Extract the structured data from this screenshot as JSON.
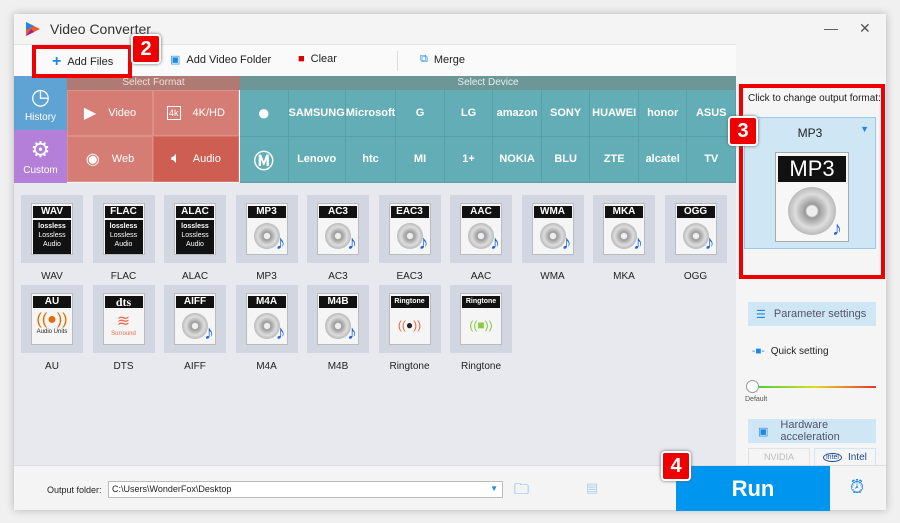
{
  "app": {
    "title": "Video Converter"
  },
  "toolbar": {
    "add_files": "Add Files",
    "add_folder": "Add Video Folder",
    "clear": "Clear",
    "merge": "Merge"
  },
  "categories": {
    "history": "History",
    "custom": "Custom",
    "select_format": "Select Format",
    "select_device": "Select Device",
    "formats": [
      "Video",
      "4K/HD",
      "Web",
      "Audio"
    ],
    "devices": [
      "",
      "SAMSUNG",
      "Microsoft",
      "G",
      "LG",
      "amazon",
      "SONY",
      "HUAWEI",
      "honor",
      "ASUS",
      "",
      "Lenovo",
      "htc",
      "MI",
      "1+",
      "NOKIA",
      "BLU",
      "ZTE",
      "alcatel",
      "TV"
    ]
  },
  "audio_formats": [
    {
      "icon": "WAV",
      "label": "WAV",
      "type": "lossless"
    },
    {
      "icon": "FLAC",
      "label": "FLAC",
      "type": "lossless"
    },
    {
      "icon": "ALAC",
      "label": "ALAC",
      "type": "lossless"
    },
    {
      "icon": "MP3",
      "label": "MP3",
      "type": "disc"
    },
    {
      "icon": "AC3",
      "label": "AC3",
      "type": "disc"
    },
    {
      "icon": "EAC3",
      "label": "EAC3",
      "type": "disc"
    },
    {
      "icon": "AAC",
      "label": "AAC",
      "type": "disc"
    },
    {
      "icon": "WMA",
      "label": "WMA",
      "type": "disc"
    },
    {
      "icon": "MKA",
      "label": "MKA",
      "type": "disc"
    },
    {
      "icon": "OGG",
      "label": "OGG",
      "type": "disc"
    },
    {
      "icon": "AU",
      "label": "AU",
      "type": "au",
      "sub": "Audio Units"
    },
    {
      "icon": "dts",
      "label": "DTS",
      "type": "dts",
      "sub": "Surround"
    },
    {
      "icon": "AIFF",
      "label": "AIFF",
      "type": "disc"
    },
    {
      "icon": "M4A",
      "label": "M4A",
      "type": "disc"
    },
    {
      "icon": "M4B",
      "label": "M4B",
      "type": "disc"
    },
    {
      "icon": "Ringtone",
      "label": "Ringtone",
      "type": "apple"
    },
    {
      "icon": "Ringtone",
      "label": "Ringtone",
      "type": "android"
    }
  ],
  "lossless_text": {
    "logo": "lossless",
    "line1": "Lossless",
    "line2": "Audio"
  },
  "output": {
    "hint": "Click to change output format:",
    "format": "MP3",
    "icon_text": "MP3"
  },
  "settings": {
    "parameter": "Parameter settings",
    "quick": "Quick setting",
    "default": "Default",
    "quality_level": 0,
    "hardware": "Hardware acceleration",
    "nvidia": "NVIDIA",
    "intel": "Intel",
    "intel_logo": "intel"
  },
  "bottom": {
    "output_label": "Output folder:",
    "output_path": "C:\\Users\\WonderFox\\Desktop",
    "run": "Run"
  },
  "badges": [
    "2",
    "3",
    "4"
  ],
  "colors": {
    "accent": "#0096f0",
    "highlight": "#e00000",
    "format_bg": "#d57d74",
    "device_bg": "#63aeb6"
  }
}
